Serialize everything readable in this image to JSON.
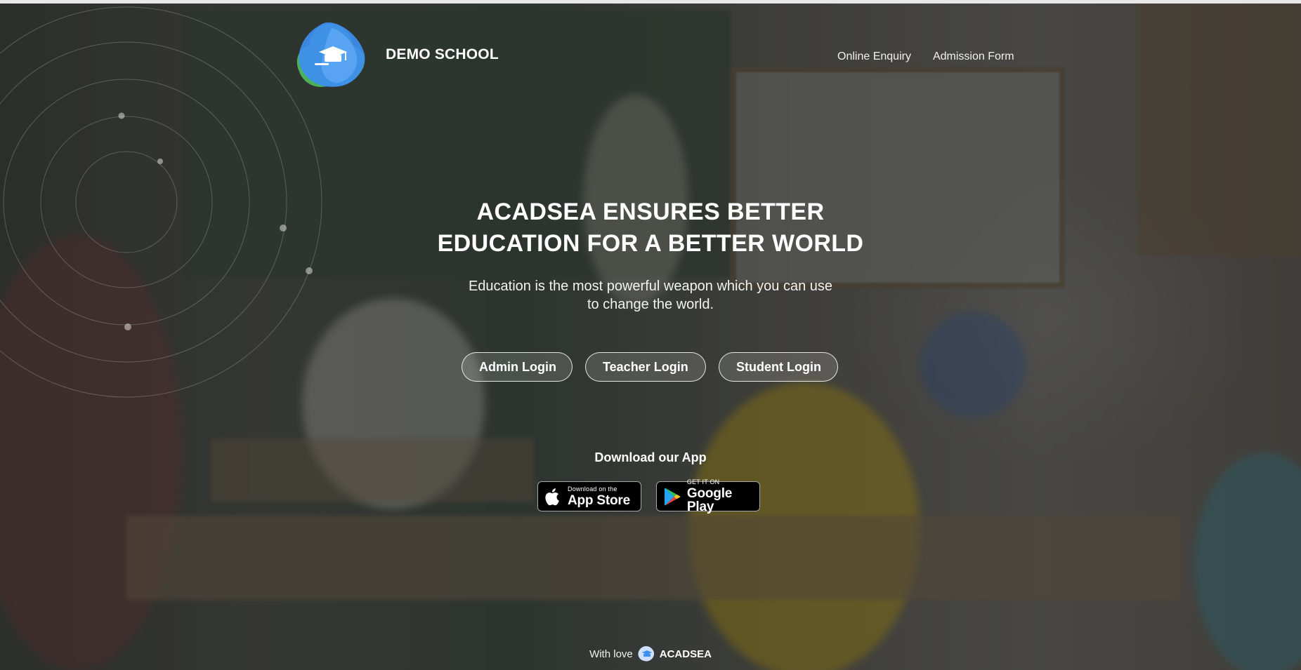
{
  "header": {
    "school_name": "DEMO SCHOOL",
    "nav": [
      {
        "label": "Online Enquiry"
      },
      {
        "label": "Admission Form"
      }
    ]
  },
  "hero": {
    "headline_line1": "ACADSEA ENSURES BETTER",
    "headline_line2": "EDUCATION FOR A BETTER WORLD",
    "subtitle_line1": "Education is the most powerful weapon which you can use",
    "subtitle_line2": "to change the world."
  },
  "logins": [
    {
      "label": "Admin Login"
    },
    {
      "label": "Teacher Login"
    },
    {
      "label": "Student Login"
    }
  ],
  "download": {
    "title": "Download our App",
    "app_store": {
      "small": "Download on the",
      "big": "App Store"
    },
    "google_play": {
      "small": "GET IT ON",
      "big": "Google Play"
    }
  },
  "footer": {
    "prefix": "With love",
    "brand": "ACADSEA"
  },
  "colors": {
    "logo_blue": "#3d8ef0",
    "logo_green": "#4cb05a",
    "overlay": "#191919"
  },
  "icons": [
    "graduation-cap-icon",
    "apple-icon",
    "google-play-icon",
    "acadsea-mini-logo-icon"
  ]
}
